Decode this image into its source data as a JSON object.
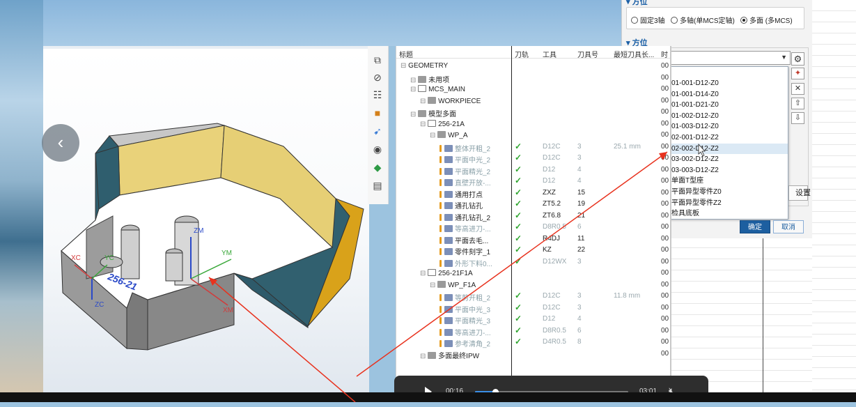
{
  "dialog": {
    "section1_title": "▾ 方位",
    "radios": [
      {
        "label": "固定3轴",
        "selected": false
      },
      {
        "label": "多轴(单MCS定轴)",
        "selected": false
      },
      {
        "label": "多面 (多MCS)",
        "selected": true
      }
    ],
    "section2_title": "▾ 方位",
    "combo_value": "",
    "dropdown_items": [
      "01-001-D12-Z0",
      "01-001-D14-Z0",
      "01-001-D21-Z0",
      "01-002-D12-Z0",
      "01-003-D12-Z0",
      "02-001-D12-Z2",
      "02-002-D12-Z2",
      "03-002-D12-Z2",
      "03-003-D12-Z2",
      "单面T型座",
      "平面异型零件Z0",
      "平面异型零件Z2",
      "检具底板"
    ],
    "selected_index": 6,
    "setup_label": "设置",
    "ok_label": "确定",
    "cancel_label": "取消"
  },
  "tree": {
    "headers": {
      "title": "标题",
      "toolpath": "刀轨",
      "tool": "工具",
      "tool_no": "刀具号",
      "min_len": "最短刀具长...",
      "last": "时"
    },
    "rows": [
      {
        "name": "GEOMETRY",
        "indent": 0,
        "icon": "none",
        "check": false,
        "tool": "",
        "num": "",
        "len": "",
        "last": "00",
        "gray": false
      },
      {
        "name": "未用项",
        "indent": 1,
        "icon": "geo",
        "check": false,
        "tool": "",
        "num": "",
        "len": "",
        "last": "00",
        "gray": false
      },
      {
        "name": "MCS_MAIN",
        "indent": 1,
        "icon": "mcs",
        "check": false,
        "tool": "",
        "num": "",
        "len": "",
        "last": "00",
        "gray": false
      },
      {
        "name": "WORKPIECE",
        "indent": 2,
        "icon": "geo",
        "check": false,
        "tool": "",
        "num": "",
        "len": "",
        "last": "00",
        "gray": false
      },
      {
        "name": "模型多面",
        "indent": 1,
        "icon": "geo",
        "check": false,
        "tool": "",
        "num": "",
        "len": "",
        "last": "00",
        "gray": false
      },
      {
        "name": "256-21A",
        "indent": 2,
        "icon": "mcs",
        "check": false,
        "tool": "",
        "num": "",
        "len": "",
        "last": "00",
        "gray": false
      },
      {
        "name": "WP_A",
        "indent": 3,
        "icon": "geo",
        "check": false,
        "tool": "",
        "num": "",
        "len": "",
        "last": "00",
        "gray": false
      },
      {
        "name": "整体开粗_2",
        "indent": 4,
        "icon": "op",
        "check": true,
        "tool": "D12C",
        "num": "3",
        "len": "25.1 mm",
        "last": "00",
        "gray": true
      },
      {
        "name": "平面中光_2",
        "indent": 4,
        "icon": "op",
        "check": true,
        "tool": "D12C",
        "num": "3",
        "len": "",
        "last": "00",
        "gray": true
      },
      {
        "name": "平面精光_2",
        "indent": 4,
        "icon": "op",
        "check": true,
        "tool": "D12",
        "num": "4",
        "len": "",
        "last": "00",
        "gray": true
      },
      {
        "name": "直壁开放-...",
        "indent": 4,
        "icon": "op",
        "check": true,
        "tool": "D12",
        "num": "4",
        "len": "",
        "last": "00",
        "gray": true
      },
      {
        "name": "通用打点",
        "indent": 4,
        "icon": "op",
        "check": true,
        "tool": "ZXZ",
        "num": "15",
        "len": "",
        "last": "00",
        "gray": false
      },
      {
        "name": "通孔钻孔",
        "indent": 4,
        "icon": "op",
        "check": true,
        "tool": "ZT5.2",
        "num": "19",
        "len": "",
        "last": "00",
        "gray": false
      },
      {
        "name": "通孔钻孔_2",
        "indent": 4,
        "icon": "op",
        "check": true,
        "tool": "ZT6.8",
        "num": "21",
        "len": "",
        "last": "00",
        "gray": false
      },
      {
        "name": "等高进刀-...",
        "indent": 4,
        "icon": "op",
        "check": true,
        "tool": "D8R0.5",
        "num": "6",
        "len": "",
        "last": "00",
        "gray": true
      },
      {
        "name": "平面去毛...",
        "indent": 4,
        "icon": "op",
        "check": true,
        "tool": "R4DJ",
        "num": "11",
        "len": "",
        "last": "00",
        "gray": false
      },
      {
        "name": "零件刻字_1",
        "indent": 4,
        "icon": "op",
        "check": true,
        "tool": "KZ",
        "num": "22",
        "len": "",
        "last": "00",
        "gray": false
      },
      {
        "name": "外形下料0...",
        "indent": 4,
        "icon": "op",
        "check": true,
        "tool": "D12WX",
        "num": "3",
        "len": "",
        "last": "00",
        "gray": true
      },
      {
        "name": "256-21F1A",
        "indent": 2,
        "icon": "mcs",
        "check": false,
        "tool": "",
        "num": "",
        "len": "",
        "last": "00",
        "gray": false
      },
      {
        "name": "WP_F1A",
        "indent": 3,
        "icon": "geo",
        "check": false,
        "tool": "",
        "num": "",
        "len": "",
        "last": "00",
        "gray": false
      },
      {
        "name": "等剪开粗_2",
        "indent": 4,
        "icon": "op",
        "check": true,
        "tool": "D12C",
        "num": "3",
        "len": "11.8 mm",
        "last": "00",
        "gray": true
      },
      {
        "name": "平面中光_3",
        "indent": 4,
        "icon": "op",
        "check": true,
        "tool": "D12C",
        "num": "3",
        "len": "",
        "last": "00",
        "gray": true
      },
      {
        "name": "平面精光_3",
        "indent": 4,
        "icon": "op",
        "check": true,
        "tool": "D12",
        "num": "4",
        "len": "",
        "last": "00",
        "gray": true
      },
      {
        "name": "等高进刀-...",
        "indent": 4,
        "icon": "op",
        "check": true,
        "tool": "D8R0.5",
        "num": "6",
        "len": "",
        "last": "00",
        "gray": true
      },
      {
        "name": "参考清角_2",
        "indent": 4,
        "icon": "op",
        "check": true,
        "tool": "D4R0.5",
        "num": "8",
        "len": "",
        "last": "00",
        "gray": true
      },
      {
        "name": "多面最终IPW",
        "indent": 2,
        "icon": "geo",
        "check": false,
        "tool": "",
        "num": "",
        "len": "",
        "last": "00",
        "gray": false
      }
    ]
  },
  "viewport": {
    "axis_zm": "ZM",
    "axis_xc": "XC",
    "axis_zc": "ZC",
    "axis_xm": "XM",
    "axis_yc": "YC",
    "axis_ym": "YM",
    "part_label": "256-21"
  },
  "video": {
    "current_time": "00:16",
    "total_time": "03:01",
    "progress": 0.13
  },
  "colors": {
    "accent": "#1d5fa0",
    "check": "#2da52d",
    "arrow": "#e8321e",
    "part_yellow": "#e8cf72",
    "part_teal": "#2f5e6e"
  }
}
